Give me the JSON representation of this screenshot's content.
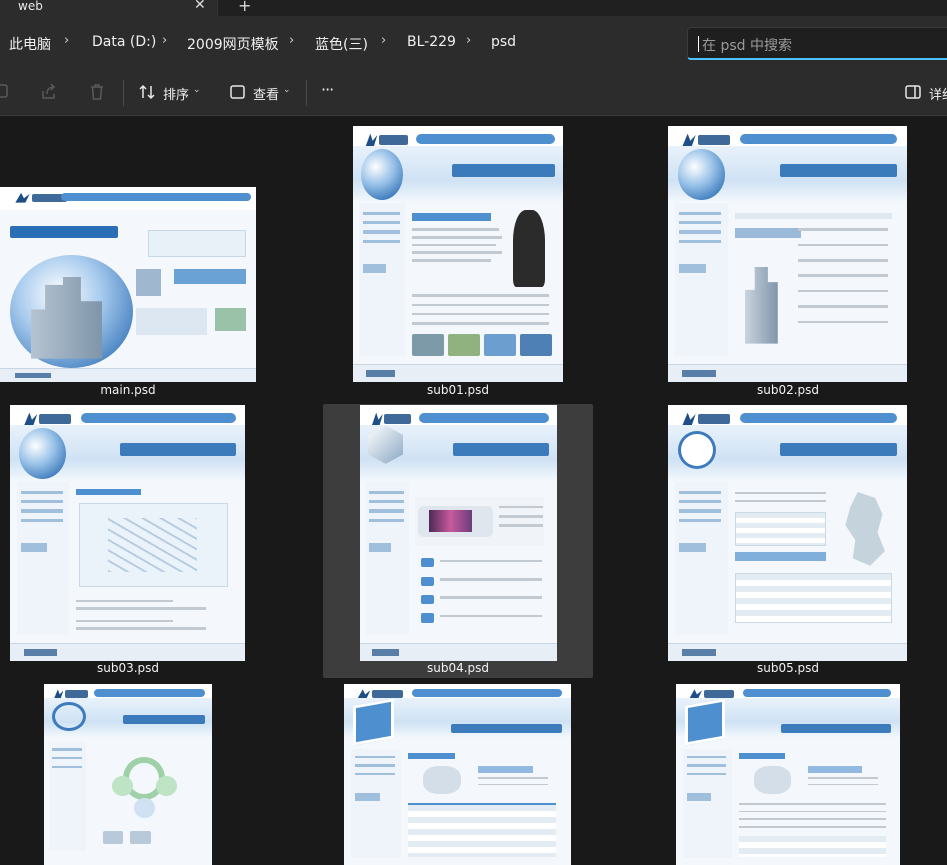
{
  "window": {
    "tab_title": "web",
    "close_glyph": "✕",
    "new_tab_glyph": "+"
  },
  "breadcrumb": [
    {
      "label": "此电脑"
    },
    {
      "label": "Data (D:)"
    },
    {
      "label": "2009网页模板"
    },
    {
      "label": "蓝色(三)"
    },
    {
      "label": "BL-229"
    },
    {
      "label": "psd"
    }
  ],
  "breadcrumb_separator": "›",
  "search": {
    "placeholder": "在 psd 中搜索"
  },
  "toolbar": {
    "sort_label": "排序",
    "view_label": "查看",
    "more_label": "···",
    "details_label": "详细",
    "chevron": "⌄"
  },
  "files": [
    {
      "name": "main.psd",
      "variant": "main"
    },
    {
      "name": "sub01.psd",
      "variant": "sub"
    },
    {
      "name": "sub02.psd",
      "variant": "sub"
    },
    {
      "name": "sub03.psd",
      "variant": "sub"
    },
    {
      "name": "sub04.psd",
      "variant": "sub",
      "selected": true
    },
    {
      "name": "sub05.psd",
      "variant": "sub"
    },
    {
      "name": "",
      "variant": "sub"
    },
    {
      "name": "",
      "variant": "sub"
    },
    {
      "name": "",
      "variant": "sub"
    }
  ],
  "colors": {
    "accent": "#4cc2ff",
    "background": "#191919",
    "chrome": "#2c2c2c",
    "selection": "#3d3d3d",
    "thumb_blue": "#2a6fb5"
  }
}
